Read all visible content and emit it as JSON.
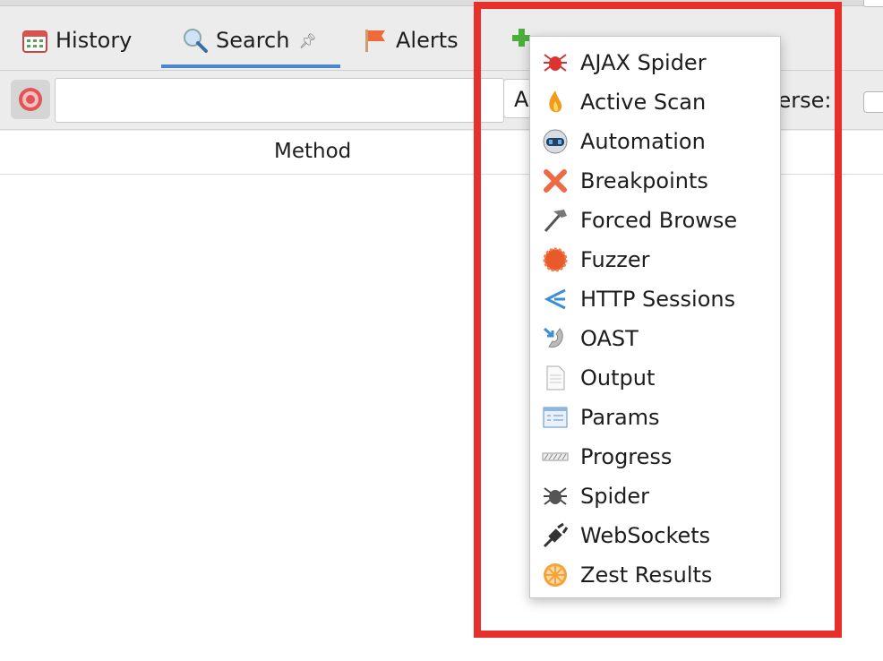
{
  "tabs": [
    {
      "label": "History",
      "icon": "calendar-icon"
    },
    {
      "label": "Search",
      "icon": "magnifier-icon",
      "active": true,
      "pinned": true
    },
    {
      "label": "Alerts",
      "icon": "flag-icon"
    }
  ],
  "toolbar": {
    "search_value": "",
    "combo_partial": "A",
    "inverse_label": "Inverse:"
  },
  "table": {
    "columns": [
      "Method"
    ]
  },
  "menu": {
    "items": [
      {
        "label": "AJAX Spider",
        "icon": "red-spider-icon"
      },
      {
        "label": "Active Scan",
        "icon": "flame-icon"
      },
      {
        "label": "Automation",
        "icon": "robot-icon"
      },
      {
        "label": "Breakpoints",
        "icon": "x-cross-icon"
      },
      {
        "label": "Forced Browse",
        "icon": "hammer-icon"
      },
      {
        "label": "Fuzzer",
        "icon": "fuzzer-gear-icon"
      },
      {
        "label": "HTTP Sessions",
        "icon": "sessions-icon"
      },
      {
        "label": "OAST",
        "icon": "oast-phone-icon"
      },
      {
        "label": "Output",
        "icon": "document-icon"
      },
      {
        "label": "Params",
        "icon": "params-icon"
      },
      {
        "label": "Progress",
        "icon": "progress-bar-icon"
      },
      {
        "label": "Spider",
        "icon": "spider-icon"
      },
      {
        "label": "WebSockets",
        "icon": "plug-icon"
      },
      {
        "label": "Zest Results",
        "icon": "orange-slice-icon"
      }
    ]
  },
  "colors": {
    "highlight": "#e8302a",
    "tab_underline": "#4a86d0"
  }
}
